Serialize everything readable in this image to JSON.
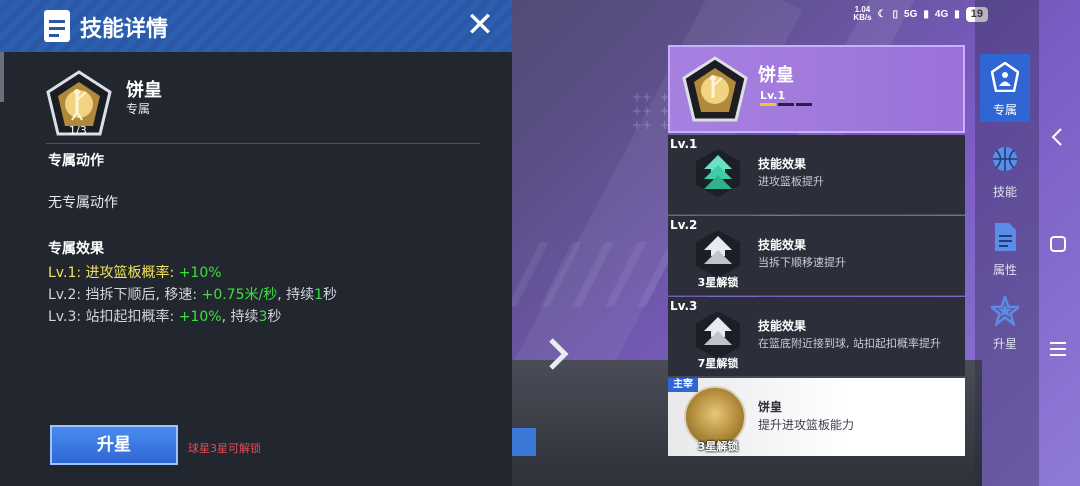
{
  "status_bar": {
    "net_speed_value": "1.04",
    "net_speed_unit": "KB/s",
    "signal_1": "5G",
    "signal_2": "4G",
    "battery": "19"
  },
  "panel": {
    "title": "技能详情",
    "close_icon": "close-icon",
    "skill_name": "饼皇",
    "skill_tag": "专属",
    "skill_progress": "1/3",
    "exclusive_action_title": "专属动作",
    "exclusive_action_text": "无专属动作",
    "exclusive_effect_title": "专属效果",
    "effects": [
      {
        "prefix": "Lv.1: 进攻篮板概率: ",
        "value": "+10%",
        "mid": "",
        "value2": "",
        "suffix": ""
      },
      {
        "prefix": "Lv.2: 挡拆下顺后, 移速: ",
        "value": "+0.75米/秒",
        "mid": ", 持续",
        "value2": "1",
        "suffix": "秒"
      },
      {
        "prefix": "Lv.3: 站扣起扣概率: ",
        "value": "+10%",
        "mid": ", 持续",
        "value2": "3",
        "suffix": "秒"
      }
    ],
    "upgrade_button": "升星",
    "upgrade_note": "球星3星可解锁"
  },
  "skill_card": {
    "name": "饼皇",
    "level": "Lv.1",
    "level_fill": 0.33
  },
  "levels": [
    {
      "label": "Lv.1",
      "title": "技能效果",
      "desc": "进攻篮板提升",
      "lock": ""
    },
    {
      "label": "Lv.2",
      "title": "技能效果",
      "desc": "当拆下顺移速提升",
      "lock": "3星解锁"
    },
    {
      "label": "Lv.3",
      "title": "技能效果",
      "desc": "在篮底附近接到球, 站扣起扣概率提升",
      "lock": "7星解锁"
    }
  ],
  "leader_card": {
    "tag": "主宰",
    "name": "饼皇",
    "desc": "提升进攻篮板能力",
    "lock": "3星解锁"
  },
  "nav": {
    "items": [
      {
        "label": "专属",
        "icon": "exclusive-icon"
      },
      {
        "label": "技能",
        "icon": "basketball-icon"
      },
      {
        "label": "属性",
        "icon": "document-icon"
      },
      {
        "label": "升星",
        "icon": "star-icon"
      }
    ]
  },
  "colors": {
    "header_blue": "#2a58a6",
    "highlight_yellow": "#f0e35a",
    "value_green": "#39e23f",
    "note_red": "#e64c55",
    "card_purple": "#a781e0"
  }
}
